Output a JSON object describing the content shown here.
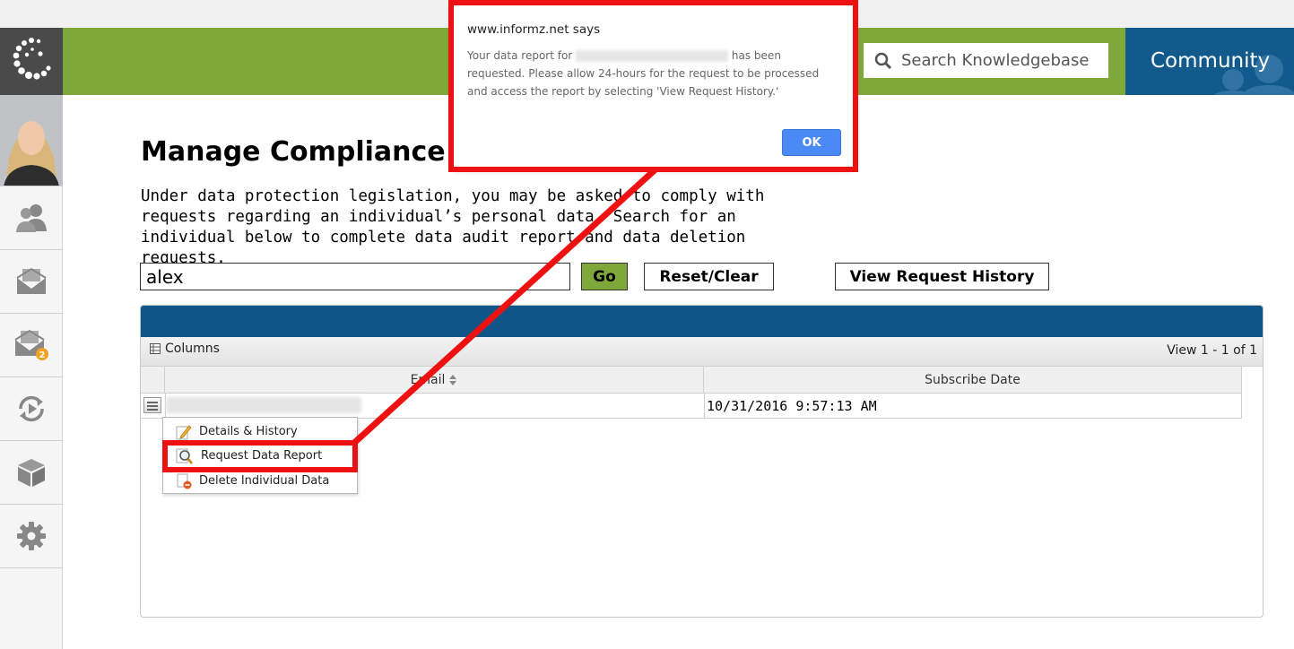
{
  "header": {
    "search_placeholder": "Search Knowledgebase",
    "community_label": "Community",
    "brand_green": "#7ea83a",
    "brand_blue": "#135a8c"
  },
  "sidebar": {
    "items": [
      {
        "icon": "users-icon"
      },
      {
        "icon": "envelope-icon"
      },
      {
        "icon": "envelope-queue-icon",
        "badge": "2"
      },
      {
        "icon": "refresh-play-icon"
      },
      {
        "icon": "box-icon"
      },
      {
        "icon": "gear-icon"
      }
    ]
  },
  "page": {
    "title": "Manage Compliance",
    "intro": "Under data protection legislation, you may be asked to comply with requests regarding an individual’s personal data. Search for an individual below to complete data audit report and data deletion requests."
  },
  "search": {
    "value": "alex",
    "go_label": "Go",
    "reset_label": "Reset/Clear",
    "history_label": "View Request History"
  },
  "grid": {
    "columns_label": "Columns",
    "view_count": "View 1 - 1 of 1",
    "headers": [
      "Email",
      "Subscribe Date"
    ],
    "rows": [
      {
        "email": "",
        "subscribe_date": "10/31/2016 9:57:13 AM"
      }
    ]
  },
  "context_menu": {
    "items": [
      {
        "label": "Details & History",
        "icon": "pencil-icon"
      },
      {
        "label": "Request Data Report",
        "icon": "magnifier-report-icon"
      },
      {
        "label": "Delete Individual Data",
        "icon": "delete-document-icon"
      }
    ]
  },
  "dialog": {
    "title": "www.informz.net says",
    "message_prefix": "Your data report for",
    "message_suffix": "has been requested. Please allow 24-hours for the request to be processed and access the report by selecting 'View Request History.'",
    "ok_label": "OK"
  },
  "annotation_color": "#ee1111"
}
